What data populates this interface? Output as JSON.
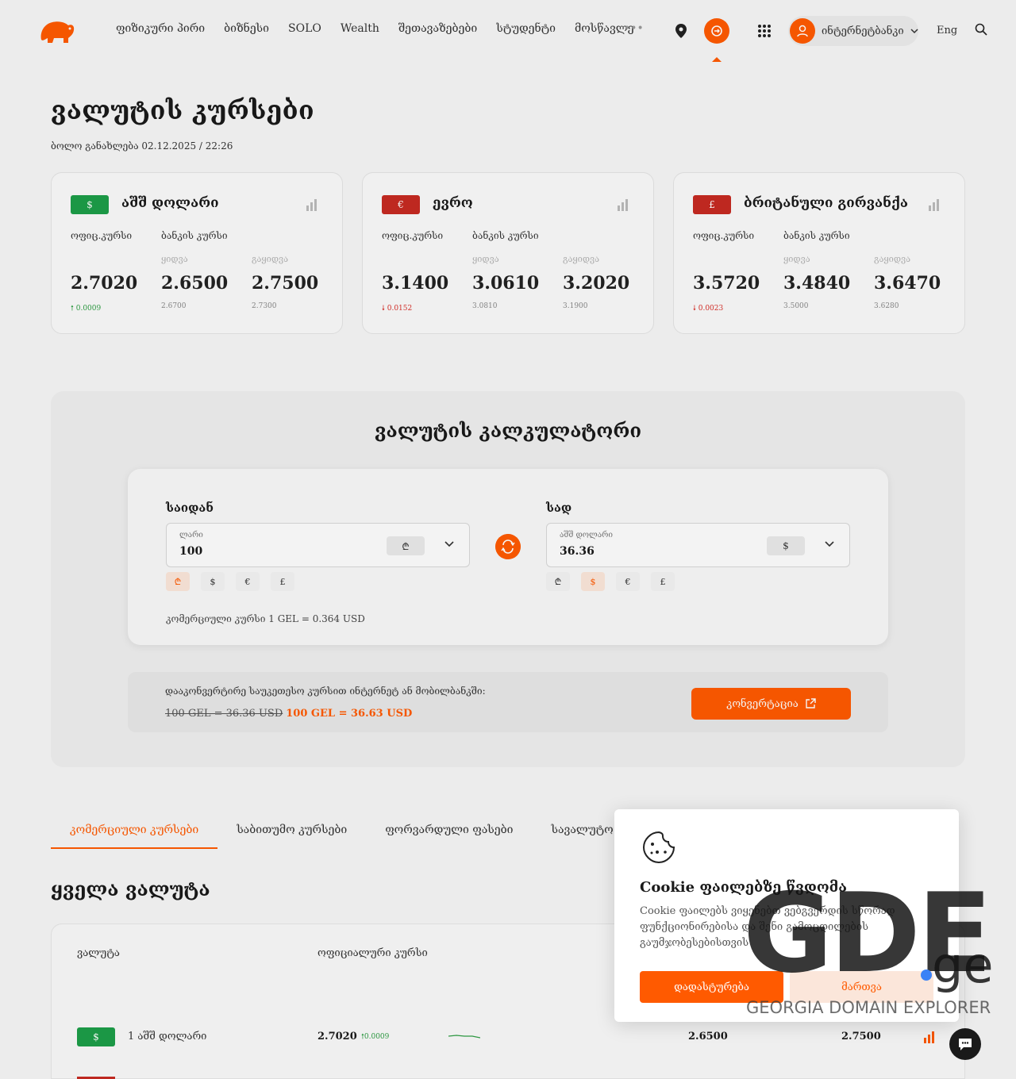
{
  "header": {
    "nav": [
      "ფიზიკური პირი",
      "ბიზნესი",
      "SOLO",
      "Wealth",
      "შეთავაზებები",
      "სტუდენტი",
      "მოსწავლე"
    ],
    "more": "•••",
    "ibank_label": "ინტერნეტბანკი",
    "lang": "Eng"
  },
  "page": {
    "title": "ვალუტის კურსები",
    "updated": "ბოლო განახლება 02.12.2025 / 22:26"
  },
  "cards": [
    {
      "symbol": "$",
      "name": "აშშ დოლარი",
      "color": "#1d9e48",
      "official_label": "ოფიც.კურსი",
      "bank_label": "ბანკის კურსი",
      "buy_label": "ყიდვა",
      "sell_label": "გაყიდვა",
      "official": "2.7020",
      "change": "0.0009",
      "dir": "up",
      "buy": "2.6500",
      "sell": "2.7500",
      "buy_prev": "2.6700",
      "sell_prev": "2.7300"
    },
    {
      "symbol": "€",
      "name": "ევრო",
      "color": "#c62a22",
      "official_label": "ოფიც.კურსი",
      "bank_label": "ბანკის კურსი",
      "buy_label": "ყიდვა",
      "sell_label": "გაყიდვა",
      "official": "3.1400",
      "change": "0.0152",
      "dir": "down",
      "buy": "3.0610",
      "sell": "3.2020",
      "buy_prev": "3.0810",
      "sell_prev": "3.1900"
    },
    {
      "symbol": "£",
      "name": "ბრიტანული გირვანქა",
      "color": "#c62a22",
      "official_label": "ოფიც.კურსი",
      "bank_label": "ბანკის კურსი",
      "buy_label": "ყიდვა",
      "sell_label": "გაყიდვა",
      "official": "3.5720",
      "change": "0.0023",
      "dir": "down",
      "buy": "3.4840",
      "sell": "3.6470",
      "buy_prev": "3.5000",
      "sell_prev": "3.6280"
    }
  ],
  "calculator": {
    "title": "ვალუტის კალკულატორი",
    "from_label": "საიდან",
    "to_label": "სად",
    "from_field_label": "ლარი",
    "from_value": "100",
    "from_currency": "₾",
    "to_field_label": "აშშ დოლარი",
    "to_value": "36.36",
    "to_currency": "$",
    "chips": [
      "₾",
      "$",
      "€",
      "£"
    ],
    "rate_line": "კომერციული კურსი 1 GEL = 0.364 USD"
  },
  "promo": {
    "text": "დააკონვერტირე საუკეთესო კურსით ინტერნეტ ან მობილბანკში:",
    "old": "100 GEL = 36.36 USD",
    "new": "100 GEL = 36.63 USD",
    "button": "კონვერტაცია"
  },
  "tabs": [
    "კომერციული კურსები",
    "საბითუმო კურსები",
    "ფორვარდული ფასები",
    "სავალუტო ოფციონი"
  ],
  "all_title": "ყველა ვალუტა",
  "table": {
    "col_currency": "ვალუტა",
    "col_official": "ოფიციალური კურსი",
    "row": {
      "symbol": "$",
      "name": "1 აშშ დოლარი",
      "official": "2.7020",
      "change": "0.0009",
      "buy": "2.6500",
      "sell": "2.7500"
    }
  },
  "cookie": {
    "title": "Cookie ფაილებზე წვდომა",
    "body": "Cookie ფაილებს ვიყენებთ ვებგვერდის სწორად ფუნქციონირებისა და შენი გამოცდილების გაუმჯობესებისთვის",
    "accept": "დადასტურება",
    "manage": "მართვა"
  },
  "watermark": {
    "big": "GDE",
    "tld": "ge",
    "sub": "GEORGIA DOMAIN EXPLORER"
  },
  "colors": {
    "accent": "#ff5a00",
    "usd": "#1d9e48",
    "eur": "#c62a22"
  }
}
